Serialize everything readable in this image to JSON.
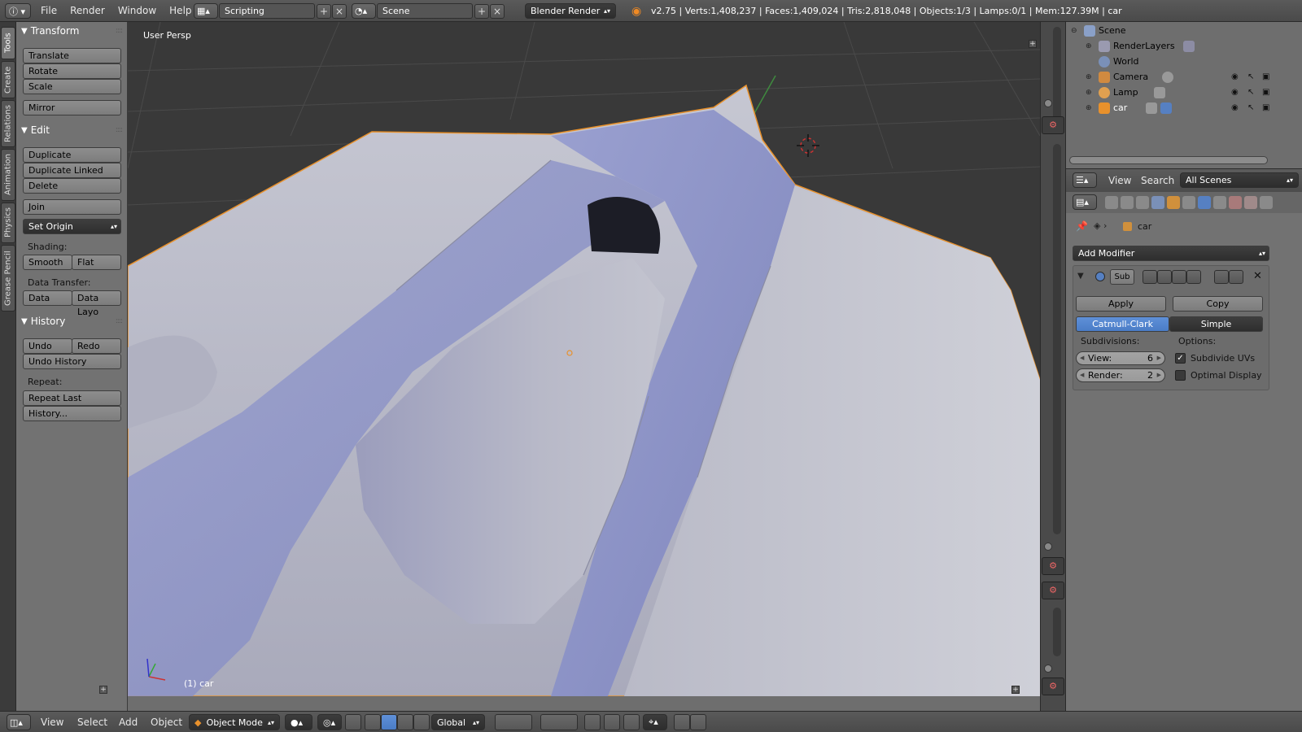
{
  "topbar": {
    "menus": [
      "File",
      "Render",
      "Window",
      "Help"
    ],
    "screen_layout": "Scripting",
    "scene": "Scene",
    "render_engine": "Blender Render",
    "stats": "v2.75 | Verts:1,408,237 | Faces:1,409,024 | Tris:2,818,048 | Objects:1/3 | Lamps:0/1 | Mem:127.39M | car"
  },
  "left_tabs": [
    "Tools",
    "Create",
    "Relations",
    "Animation",
    "Physics",
    "Grease Pencil"
  ],
  "toolshelf": {
    "transform": {
      "title": "Transform",
      "buttons": [
        "Translate",
        "Rotate",
        "Scale",
        "Mirror"
      ]
    },
    "edit": {
      "title": "Edit",
      "buttons": [
        "Duplicate",
        "Duplicate Linked",
        "Delete",
        "Join"
      ],
      "set_origin": "Set Origin",
      "shading_label": "Shading:",
      "shading": [
        "Smooth",
        "Flat"
      ],
      "data_transfer_label": "Data Transfer:",
      "data_transfer": [
        "Data",
        "Data Layo"
      ]
    },
    "history": {
      "title": "History",
      "undo": "Undo",
      "redo": "Redo",
      "undo_history": "Undo History",
      "repeat_label": "Repeat:",
      "repeat_last": "Repeat Last",
      "history_btn": "History..."
    }
  },
  "viewport": {
    "view_name": "User Persp",
    "object_label": "(1) car"
  },
  "outliner": {
    "items": [
      {
        "label": "Scene",
        "icon": "scene-icon"
      },
      {
        "label": "RenderLayers",
        "icon": "renderlayers-icon"
      },
      {
        "label": "World",
        "icon": "world-icon"
      },
      {
        "label": "Camera",
        "icon": "camera-icon"
      },
      {
        "label": "Lamp",
        "icon": "lamp-icon"
      },
      {
        "label": "car",
        "icon": "mesh-icon"
      }
    ]
  },
  "properties": {
    "header_menus": [
      "View",
      "Search"
    ],
    "scenes_dropdown": "All Scenes",
    "context_object": "car",
    "add_modifier": "Add Modifier",
    "modifier_name": "Sub",
    "apply": "Apply",
    "copy": "Copy",
    "subdiv_types": [
      "Catmull-Clark",
      "Simple"
    ],
    "subdiv_type_active": "Catmull-Clark",
    "subdivisions_label": "Subdivisions:",
    "options_label": "Options:",
    "view_label": "View:",
    "view_value": "6",
    "render_label": "Render:",
    "render_value": "2",
    "subdivide_uvs": "Subdivide UVs",
    "subdivide_uvs_checked": true,
    "optimal_display": "Optimal Display",
    "optimal_display_checked": false
  },
  "bottombar": {
    "menus": [
      "View",
      "Select",
      "Add",
      "Object"
    ],
    "mode": "Object Mode",
    "orientation": "Global"
  },
  "colors": {
    "selected_outline": "#e8912c",
    "active_blue": "#5680c2",
    "mesh_base": "#b4b6c6",
    "mesh_blue": "#8f96c8"
  }
}
